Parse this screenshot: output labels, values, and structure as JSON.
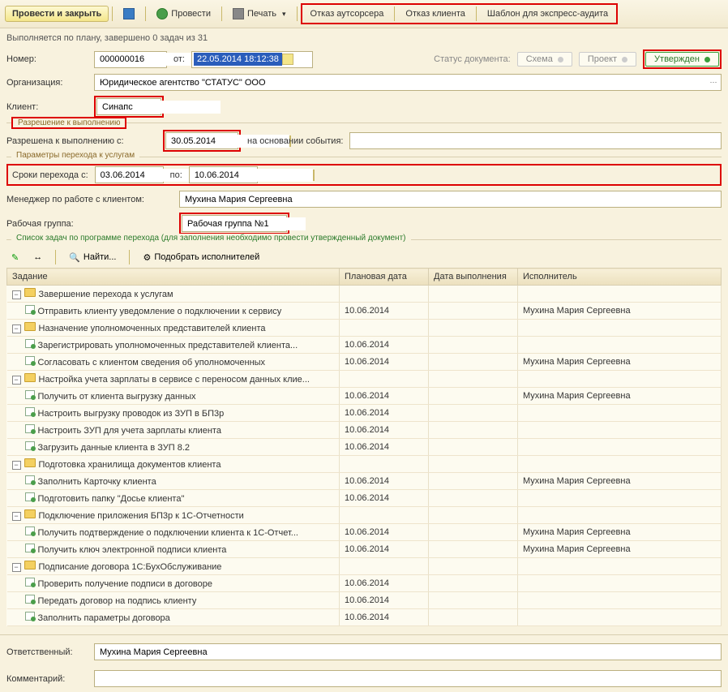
{
  "toolbar": {
    "save_close": "Провести и закрыть",
    "post": "Провести",
    "print": "Печать",
    "reject_outsourcer": "Отказ аутсорсера",
    "reject_client": "Отказ клиента",
    "express_template": "Шаблон для экспресс-аудита"
  },
  "status_line": "Выполняется по плану,  завершено 0 задач из 31",
  "form": {
    "number_label": "Номер:",
    "number": "000000016",
    "from_label": "от:",
    "date": "22.05.2014 18:12:38",
    "doc_status_label": "Статус документа:",
    "status_scheme": "Схема",
    "status_project": "Проект",
    "status_approved": "Утвержден",
    "org_label": "Организация:",
    "org": "Юридическое агентство \"СТАТУС\" ООО",
    "client_label": "Клиент:",
    "client": "Синапс"
  },
  "permission": {
    "title": "Разрешение к выполнению",
    "allowed_from_label": "Разрешена к выполнению с:",
    "allowed_from": "30.05.2014",
    "based_on_label": "на основании события:",
    "based_on": ""
  },
  "transition": {
    "title": "Параметры перехода к услугам",
    "period_label": "Сроки перехода      с:",
    "from": "03.06.2014",
    "to_label": "по:",
    "to": "10.06.2014",
    "manager_label": "Менеджер по работе с клиентом:",
    "manager": "Мухина Мария Сергеевна",
    "group_label": "Рабочая группа:",
    "group": "Рабочая группа №1"
  },
  "tasks_section": {
    "title": "Список задач по программе перехода (для заполнения необходимо провести утвержденный документ)",
    "find": "Найти...",
    "pick": "Подобрать исполнителей"
  },
  "columns": {
    "task": "Задание",
    "plan_date": "Плановая дата",
    "done_date": "Дата выполнения",
    "executor": "Исполнитель"
  },
  "rows": [
    {
      "type": "group",
      "text": "Завершение перехода к услугам"
    },
    {
      "type": "task",
      "text": "Отправить клиенту уведомление о подключении к сервису",
      "date": "10.06.2014",
      "exec": "Мухина Мария Сергеевна"
    },
    {
      "type": "group",
      "text": "Назначение уполномоченных представителей клиента"
    },
    {
      "type": "task",
      "text": "Зарегистрировать уполномоченных представителей клиента...",
      "date": "10.06.2014",
      "exec": ""
    },
    {
      "type": "task",
      "text": "Согласовать с клиентом сведения об уполномоченных",
      "date": "10.06.2014",
      "exec": "Мухина Мария Сергеевна"
    },
    {
      "type": "group",
      "text": "Настройка учета зарплаты в сервисе с переносом данных клие..."
    },
    {
      "type": "task",
      "text": "Получить от клиента выгрузку данных",
      "date": "10.06.2014",
      "exec": "Мухина Мария Сергеевна"
    },
    {
      "type": "task",
      "text": "Настроить выгрузку проводок из ЗУП в БП3р",
      "date": "10.06.2014",
      "exec": ""
    },
    {
      "type": "task",
      "text": "Настроить ЗУП для учета зарплаты клиента",
      "date": "10.06.2014",
      "exec": ""
    },
    {
      "type": "task",
      "text": "Загрузить данные клиента в ЗУП 8.2",
      "date": "10.06.2014",
      "exec": ""
    },
    {
      "type": "group",
      "text": "Подготовка хранилища документов клиента"
    },
    {
      "type": "task",
      "text": "Заполнить Карточку клиента",
      "date": "10.06.2014",
      "exec": "Мухина Мария Сергеевна"
    },
    {
      "type": "task",
      "text": "Подготовить папку \"Досье клиента\"",
      "date": "10.06.2014",
      "exec": ""
    },
    {
      "type": "group",
      "text": "Подключение приложения БП3р к 1С-Отчетности"
    },
    {
      "type": "task",
      "text": "Получить подтверждение о подключении клиента к 1С-Отчет...",
      "date": "10.06.2014",
      "exec": "Мухина Мария Сергеевна"
    },
    {
      "type": "task",
      "text": "Получить ключ электронной подписи клиента",
      "date": "10.06.2014",
      "exec": "Мухина Мария Сергеевна"
    },
    {
      "type": "group",
      "text": "Подписание договора 1С:БухОбслуживание"
    },
    {
      "type": "task",
      "text": "Проверить получение подписи в договоре",
      "date": "10.06.2014",
      "exec": ""
    },
    {
      "type": "task",
      "text": "Передать договор на подпись клиенту",
      "date": "10.06.2014",
      "exec": ""
    },
    {
      "type": "task",
      "text": "Заполнить параметры договора",
      "date": "10.06.2014",
      "exec": ""
    }
  ],
  "footer": {
    "responsible_label": "Ответственный:",
    "responsible": "Мухина Мария Сергеевна",
    "comment_label": "Комментарий:",
    "comment": ""
  }
}
